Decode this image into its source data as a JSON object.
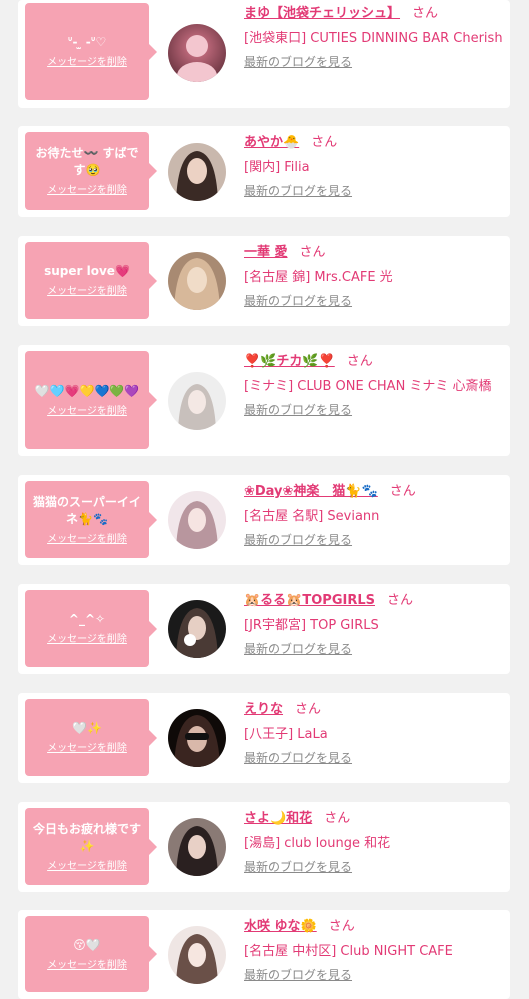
{
  "items": [
    {
      "message": "ᐡ- ̫ -ᐡ♡",
      "delete_label": "メッセージを削除",
      "name": "まゆ【池袋チェリッシュ】",
      "san": "さん",
      "shop": "[池袋東口] CUTIES DINNING BAR Cherish",
      "blog_label": "最新のブログを見る",
      "avatar_colors": [
        "#d97a8e",
        "#5a2a35"
      ]
    },
    {
      "message": "お待たせ〰️ すばです🥹",
      "delete_label": "メッセージを削除",
      "name": "あやか🐣",
      "san": "さん",
      "shop": "[関内] Filia",
      "blog_label": "最新のブログを見る",
      "avatar_colors": [
        "#c9b8ad",
        "#3a2a25"
      ]
    },
    {
      "message": "super love💗",
      "delete_label": "メッセージを削除",
      "name": "一華 愛",
      "san": "さん",
      "shop": "[名古屋 錦] Mrs.CAFE 光",
      "blog_label": "最新のブログを見る",
      "avatar_colors": [
        "#d7b89a",
        "#6a4a38"
      ]
    },
    {
      "message": "🤍🩵💗💛💙💚💜",
      "delete_label": "メッセージを削除",
      "name": "❣️🌿チカ🌿❣️",
      "san": "さん",
      "shop": "[ミナミ] CLUB ONE CHAN ミナミ 心斎橋",
      "blog_label": "最新のブログを見る",
      "avatar_colors": [
        "#eeeeee",
        "#c8c0bc"
      ]
    },
    {
      "message": "猫猫のスーパーイイネ🐈🐾",
      "delete_label": "メッセージを削除",
      "name": "❀Day❀神楽　猫🐈🐾",
      "san": "さん",
      "shop": "[名古屋 名駅] Seviann",
      "blog_label": "最新のブログを見る",
      "avatar_colors": [
        "#f1e6ea",
        "#b8969e"
      ]
    },
    {
      "message": "^_^✧",
      "delete_label": "メッセージを削除",
      "name": "🐹るる🐹TOPGIRLS",
      "san": "さん",
      "shop": "[JR宇都宮] TOP GIRLS",
      "blog_label": "最新のブログを見る",
      "avatar_colors": [
        "#4a3a35",
        "#1a1a1a"
      ]
    },
    {
      "message": "🤍✨",
      "delete_label": "メッセージを削除",
      "name": "えりな",
      "san": "さん",
      "shop": "[八王子] LaLa",
      "blog_label": "最新のブログを見る",
      "avatar_colors": [
        "#3a2520",
        "#0f0a08"
      ]
    },
    {
      "message": "今日もお疲れ様です✨",
      "delete_label": "メッセージを削除",
      "name": "さよ🌙和花",
      "san": "さん",
      "shop": "[湯島] club lounge 和花",
      "blog_label": "最新のブログを見る",
      "avatar_colors": [
        "#8a7a75",
        "#2a2020"
      ]
    },
    {
      "message": "😚🤍",
      "delete_label": "メッセージを削除",
      "name": "水咲 ゆな🌼",
      "san": "さん",
      "shop": "[名古屋 中村区] Club NIGHT CAFE",
      "blog_label": "最新のブログを見る",
      "avatar_colors": [
        "#efe6e4",
        "#6a5048"
      ]
    }
  ]
}
